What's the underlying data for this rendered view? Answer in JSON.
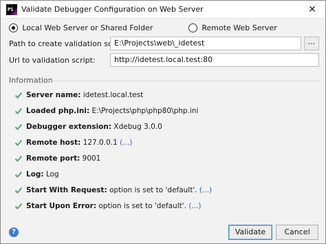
{
  "window": {
    "app_icon_text": "PS",
    "title": "Validate Debugger Configuration on Web Server",
    "close_glyph": "✕"
  },
  "mode": {
    "local_label": "Local Web Server or Shared Folder",
    "local_selected": true,
    "remote_label": "Remote Web Server",
    "remote_selected": false
  },
  "form": {
    "path_label": "Path to create validation script:",
    "path_value": "E:\\Projects\\web\\_idetest",
    "browse_label": "...",
    "url_label": "Url to validation script:",
    "url_value": "http://idetest.local.test:80"
  },
  "information": {
    "header": "Information",
    "items": [
      {
        "key": "Server name:",
        "value": "idetest.local.test",
        "link": ""
      },
      {
        "key": "Loaded php.ini:",
        "value": "E:\\Projects\\php\\php80\\php.ini",
        "link": ""
      },
      {
        "key": "Debugger extension:",
        "value": "Xdebug 3.0.0",
        "link": ""
      },
      {
        "key": "Remote host:",
        "value": "127.0.0.1",
        "link": "(...)"
      },
      {
        "key": "Remote port:",
        "value": "9001",
        "link": ""
      },
      {
        "key": "Log:",
        "value": "Log",
        "link": ""
      },
      {
        "key": "Start With Request:",
        "value": "option is set to 'default'.",
        "link": "(...)"
      },
      {
        "key": "Start Upon Error:",
        "value": "option is set to 'default'.",
        "link": "(...)"
      }
    ],
    "check_color": "#59a869",
    "link_color": "#2a5db0"
  },
  "footer": {
    "help_glyph": "?",
    "validate_label": "Validate",
    "cancel_label": "Cancel"
  }
}
